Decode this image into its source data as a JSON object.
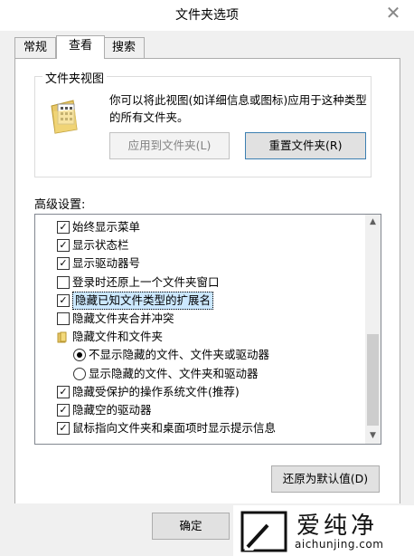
{
  "window": {
    "title": "文件夹选项",
    "close_glyph": "✕"
  },
  "tabs": [
    {
      "label": "常规",
      "active": false
    },
    {
      "label": "查看",
      "active": true
    },
    {
      "label": "搜索",
      "active": false
    }
  ],
  "folder_views": {
    "group_title": "文件夹视图",
    "description": "你可以将此视图(如详细信息或图标)应用于这种类型的所有文件夹。",
    "apply_button": "应用到文件夹(L)",
    "reset_button": "重置文件夹(R)"
  },
  "advanced": {
    "label": "高级设置:",
    "items": [
      {
        "text": "始终显示菜单",
        "kind": "checkbox",
        "checked": true,
        "selected": false
      },
      {
        "text": "显示状态栏",
        "kind": "checkbox",
        "checked": true,
        "selected": false
      },
      {
        "text": "显示驱动器号",
        "kind": "checkbox",
        "checked": true,
        "selected": false
      },
      {
        "text": "登录时还原上一个文件夹窗口",
        "kind": "checkbox",
        "checked": false,
        "selected": false
      },
      {
        "text": "隐藏已知文件类型的扩展名",
        "kind": "checkbox",
        "checked": true,
        "selected": true
      },
      {
        "text": "隐藏文件夹合并冲突",
        "kind": "checkbox",
        "checked": false,
        "selected": false
      },
      {
        "text": "隐藏文件和文件夹",
        "kind": "folder",
        "checked": false,
        "selected": false
      },
      {
        "text": "不显示隐藏的文件、文件夹或驱动器",
        "kind": "radio",
        "checked": true,
        "selected": false
      },
      {
        "text": "显示隐藏的文件、文件夹和驱动器",
        "kind": "radio",
        "checked": false,
        "selected": false
      },
      {
        "text": "隐藏受保护的操作系统文件(推荐)",
        "kind": "checkbox",
        "checked": true,
        "selected": false
      },
      {
        "text": "隐藏空的驱动器",
        "kind": "checkbox",
        "checked": true,
        "selected": false
      },
      {
        "text": "鼠标指向文件夹和桌面项时显示提示信息",
        "kind": "checkbox",
        "checked": true,
        "selected": false
      }
    ],
    "restore_defaults_button": "还原为默认值(D)"
  },
  "footer": {
    "ok_button": "确定"
  },
  "watermark": {
    "name": "爱纯净",
    "url": "aichunjing.com"
  },
  "colors": {
    "selection": "#cce8ff",
    "primary_border": "#3c7fb1"
  }
}
